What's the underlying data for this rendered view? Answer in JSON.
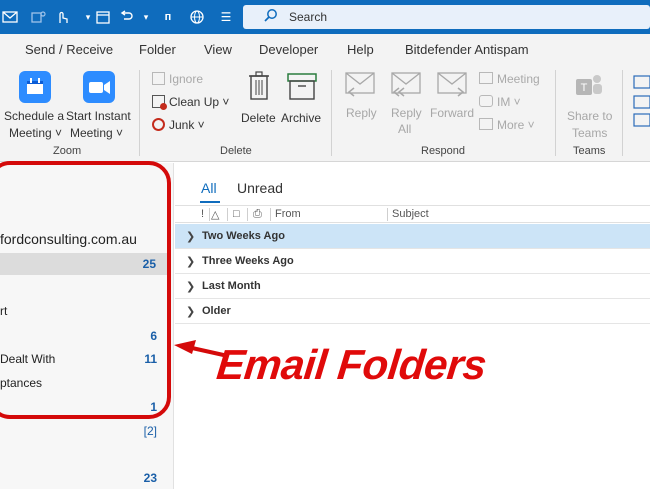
{
  "titlebar": {
    "search_placeholder": "Search",
    "icons": [
      "mail-icon",
      "teams-icon",
      "touch-icon",
      "calendar-icon",
      "undo-icon",
      "translate-icon",
      "globe-icon",
      "dropdown-icon"
    ]
  },
  "menu": [
    "Send / Receive",
    "Folder",
    "View",
    "Developer",
    "Help",
    "Bitdefender Antispam"
  ],
  "ribbon": {
    "zoom": {
      "group_label": "Zoom",
      "schedule_line1": "Schedule a",
      "schedule_line2": "Meeting ˅",
      "instant_line1": "Start Instant",
      "instant_line2": "Meeting ˅"
    },
    "delete": {
      "group_label": "Delete",
      "ignore": "Ignore",
      "cleanup": "Clean Up ˅",
      "junk": "Junk ˅",
      "delete": "Delete",
      "archive": "Archive"
    },
    "respond": {
      "group_label": "Respond",
      "reply": "Reply",
      "reply_all_1": "Reply",
      "reply_all_2": "All",
      "forward": "Forward",
      "meeting": "Meeting",
      "im": "IM ˅",
      "more": "More ˅"
    },
    "teams": {
      "group_label": "Teams",
      "share_1": "Share to",
      "share_2": "Teams"
    }
  },
  "folders": {
    "account": "fordconsulting.com.au",
    "items": [
      {
        "label": "",
        "count": "25"
      },
      {
        "label": "rt",
        "count": ""
      },
      {
        "label": "",
        "count": "6"
      },
      {
        "label": "Dealt With",
        "count": "11"
      },
      {
        "label": "ptances",
        "count": ""
      },
      {
        "label": "",
        "count": "1"
      },
      {
        "label": "",
        "count": "[2]"
      },
      {
        "label": "",
        "count": "23"
      }
    ]
  },
  "messages": {
    "tabs": {
      "all": "All",
      "unread": "Unread"
    },
    "columns": {
      "from": "From",
      "subject": "Subject",
      "flags": [
        "!",
        "△",
        "□",
        "⎙"
      ]
    },
    "groups": [
      "Two Weeks Ago",
      "Three Weeks Ago",
      "Last Month",
      "Older"
    ]
  },
  "annotation": {
    "text": "Email Folders",
    "color": "#e00a0a"
  },
  "colors": {
    "titlebar": "#0f6cbd",
    "selected_group": "#cce4f7",
    "count_blue": "#1a5fa8"
  }
}
